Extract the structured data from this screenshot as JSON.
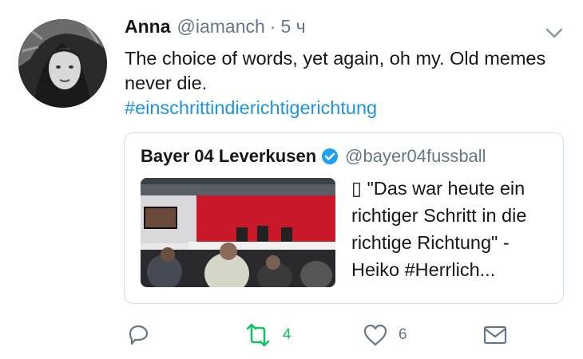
{
  "tweet": {
    "author_name": "Anna",
    "author_handle": "@iamanch",
    "separator": "·",
    "time": "5 ч",
    "text": "The choice of words, yet again, oh my. Old memes never die.",
    "hashtag": "#einschrittindierichtigerichtung"
  },
  "quoted": {
    "author_name": "Bayer 04 Leverkusen",
    "author_handle": "@bayer04fussball",
    "text": "▯ \"Das war heute ein richtiger Schritt in die richtige Richtung\" - Heiko #Herrlich..."
  },
  "actions": {
    "retweet_count": "4",
    "like_count": "6"
  },
  "colors": {
    "link": "#1b95e0",
    "retweet": "#17bf63",
    "muted": "#657786",
    "verified": "#1da1f2"
  },
  "icons": [
    "chevron-down-icon",
    "verified-icon",
    "reply-icon",
    "retweet-icon",
    "like-icon",
    "message-icon"
  ]
}
